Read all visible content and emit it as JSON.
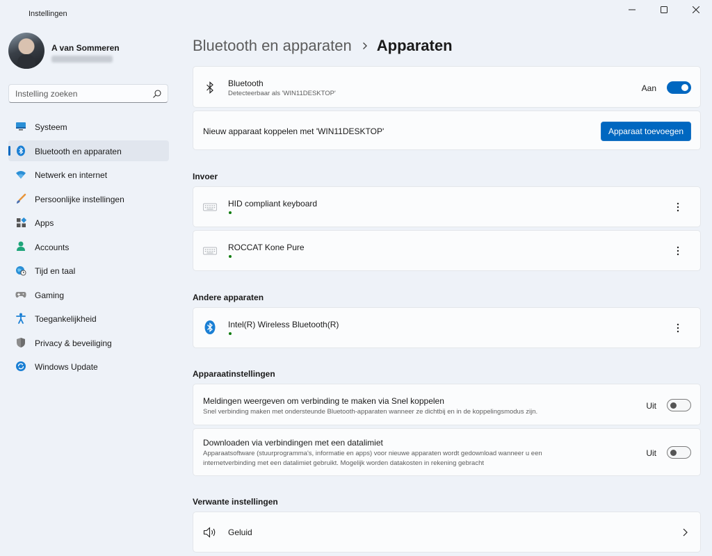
{
  "window": {
    "title": "Instellingen",
    "controls": [
      "minimize-icon",
      "maximize-icon",
      "close-icon"
    ]
  },
  "profile": {
    "name": "A van Sommeren"
  },
  "search": {
    "placeholder": "Instelling zoeken",
    "icon": "search-icon"
  },
  "sidebar": {
    "items": [
      {
        "label": "Systeem",
        "icon": "monitor-icon",
        "active": false
      },
      {
        "label": "Bluetooth en apparaten",
        "icon": "bluetooth-icon",
        "active": true
      },
      {
        "label": "Netwerk en internet",
        "icon": "wifi-icon",
        "active": false
      },
      {
        "label": "Persoonlijke instellingen",
        "icon": "brush-icon",
        "active": false
      },
      {
        "label": "Apps",
        "icon": "apps-icon",
        "active": false
      },
      {
        "label": "Accounts",
        "icon": "person-icon",
        "active": false
      },
      {
        "label": "Tijd en taal",
        "icon": "globe-clock-icon",
        "active": false
      },
      {
        "label": "Gaming",
        "icon": "gamepad-icon",
        "active": false
      },
      {
        "label": "Toegankelijkheid",
        "icon": "accessibility-icon",
        "active": false
      },
      {
        "label": "Privacy & beveiliging",
        "icon": "shield-icon",
        "active": false
      },
      {
        "label": "Windows Update",
        "icon": "update-icon",
        "active": false
      }
    ]
  },
  "breadcrumb": {
    "parent": "Bluetooth en apparaten",
    "current": "Apparaten"
  },
  "bluetooth": {
    "title": "Bluetooth",
    "subtitle": "Detecteerbaar als 'WIN11DESKTOP'",
    "state_label": "Aan",
    "enabled": true
  },
  "pairing": {
    "text": "Nieuw apparaat koppelen met 'WIN11DESKTOP'",
    "button": "Apparaat toevoegen"
  },
  "sections": {
    "input": "Invoer",
    "other": "Andere apparaten",
    "device_settings": "Apparaatinstellingen",
    "related": "Verwante instellingen"
  },
  "input_devices": [
    {
      "name": "HID compliant keyboard",
      "icon": "keyboard-icon",
      "connected": true
    },
    {
      "name": "ROCCAT Kone Pure",
      "icon": "keyboard-icon",
      "connected": true
    }
  ],
  "other_devices": [
    {
      "name": "Intel(R) Wireless Bluetooth(R)",
      "icon": "bluetooth-icon",
      "connected": true
    }
  ],
  "device_settings": [
    {
      "title": "Meldingen weergeven om verbinding te maken via Snel koppelen",
      "subtitle": "Snel verbinding maken met ondersteunde Bluetooth-apparaten wanneer ze dichtbij en in de koppelingsmodus zijn.",
      "state_label": "Uit",
      "enabled": false
    },
    {
      "title": "Downloaden via verbindingen met een datalimiet",
      "subtitle_line1": "Apparaatsoftware (stuurprogramma's, informatie en apps) voor nieuwe apparaten wordt gedownload wanneer u een",
      "subtitle_line2": "internetverbinding met een datalimiet gebruikt. Mogelijk worden datakosten in rekening gebracht",
      "state_label": "Uit",
      "enabled": false
    }
  ],
  "related": [
    {
      "label": "Geluid",
      "icon": "speaker-icon"
    }
  ],
  "colors": {
    "accent": "#0067c0",
    "background": "#eef2f8",
    "card": "#fbfcfd",
    "status_connected": "#107c10"
  }
}
